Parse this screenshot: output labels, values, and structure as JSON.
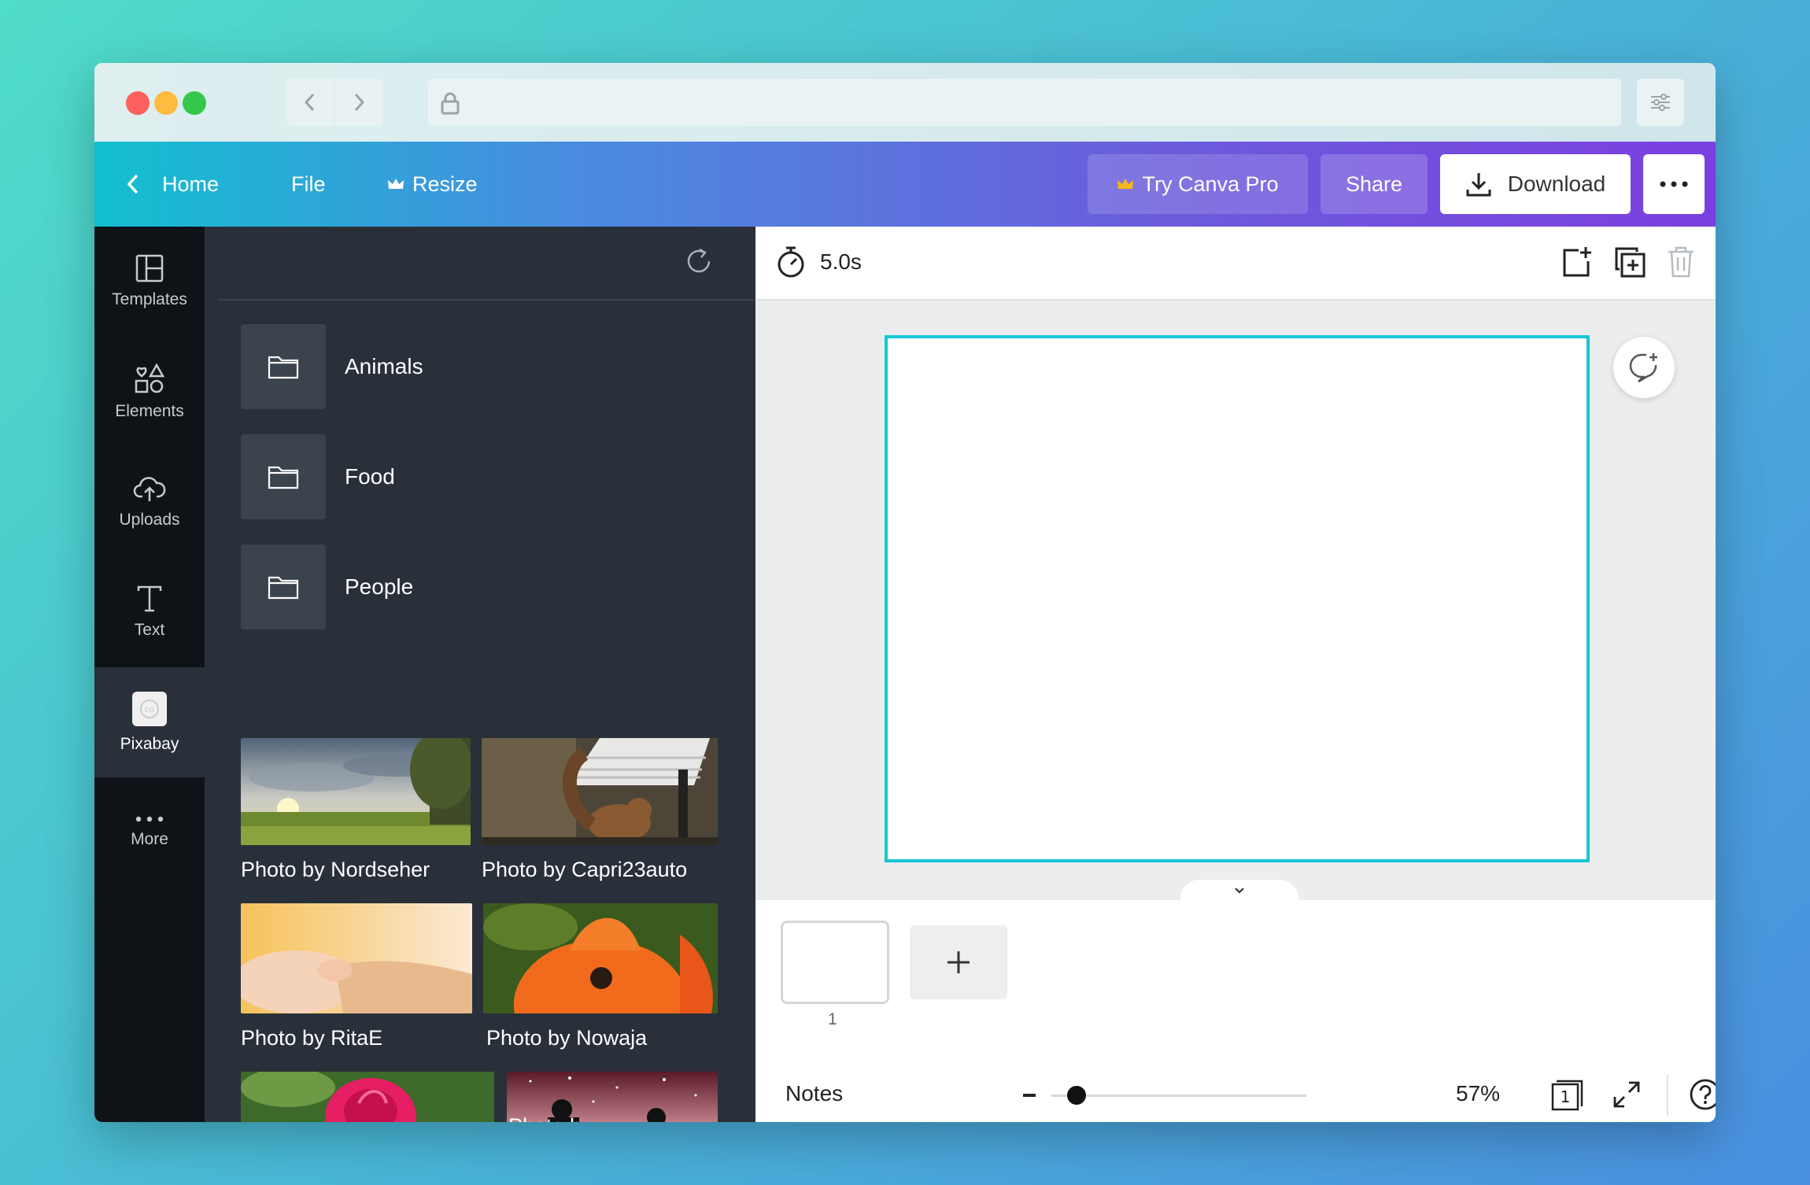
{
  "topbar": {
    "home_label": "Home",
    "file_label": "File",
    "resize_label": "Resize",
    "try_pro_label": "Try Canva Pro",
    "share_label": "Share",
    "download_label": "Download",
    "crown_color": "#f5b51d"
  },
  "rail": {
    "items": [
      {
        "label": "Templates",
        "icon": "templates-icon"
      },
      {
        "label": "Elements",
        "icon": "elements-icon"
      },
      {
        "label": "Uploads",
        "icon": "cloud-upload-icon"
      },
      {
        "label": "Text",
        "icon": "text-icon"
      },
      {
        "label": "Pixabay",
        "icon": "pixabay-icon",
        "active": true
      },
      {
        "label": "More",
        "icon": "more-icon"
      }
    ]
  },
  "panel": {
    "folders": [
      {
        "label": "Animals"
      },
      {
        "label": "Food"
      },
      {
        "label": "People"
      }
    ],
    "photos": [
      {
        "caption": "Photo by Nordseher"
      },
      {
        "caption": "Photo by Capri23auto"
      },
      {
        "caption": "Photo by RitaE"
      },
      {
        "caption": "Photo by Nowaja"
      },
      {
        "caption": ""
      },
      {
        "caption": "Photo by ..."
      }
    ]
  },
  "editor": {
    "duration": "5.0s",
    "page_number": "1",
    "notes_label": "Notes",
    "zoom_percent": "57%",
    "zoom_level": 0.1,
    "page_count_badge": "1",
    "canvas_border_color": "#14c8d4"
  }
}
